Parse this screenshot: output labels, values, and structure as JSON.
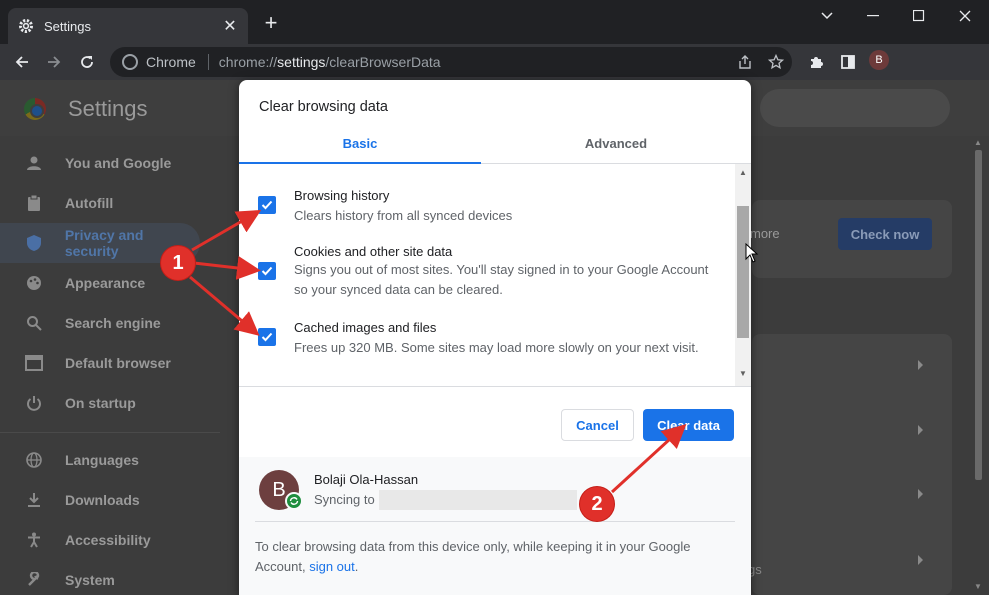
{
  "browser": {
    "tab_title": "Settings",
    "close_glyph": "✕",
    "newtab_glyph": "+",
    "omnibox_chip": "Chrome",
    "url_scheme": "chrome://",
    "url_host": "settings",
    "url_path": "/clearBrowserData",
    "profile_initial": "B"
  },
  "settings": {
    "title": "Settings",
    "sidebar": [
      {
        "label": "You and Google",
        "icon": "person-icon"
      },
      {
        "label": "Autofill",
        "icon": "clipboard-icon"
      },
      {
        "label": "Privacy and security",
        "icon": "shield-icon"
      },
      {
        "label": "Appearance",
        "icon": "palette-icon"
      },
      {
        "label": "Search engine",
        "icon": "search-icon"
      },
      {
        "label": "Default browser",
        "icon": "browser-icon"
      },
      {
        "label": "On startup",
        "icon": "power-icon"
      },
      {
        "label": "Languages",
        "icon": "globe-icon"
      },
      {
        "label": "Downloads",
        "icon": "download-icon"
      },
      {
        "label": "Accessibility",
        "icon": "accessibility-icon"
      },
      {
        "label": "System",
        "icon": "wrench-icon"
      }
    ],
    "safety_more_text": "more",
    "check_now_label": "Check now",
    "partial_text": "gs"
  },
  "dialog": {
    "title": "Clear browsing data",
    "tabs": [
      "Basic",
      "Advanced"
    ],
    "active_tab": "Basic",
    "options": [
      {
        "label": "Browsing history",
        "desc": "Clears history from all synced devices",
        "checked": true
      },
      {
        "label": "Cookies and other site data",
        "desc": "Signs you out of most sites. You'll stay signed in to your Google Account so your synced data can be cleared.",
        "checked": true
      },
      {
        "label": "Cached images and files",
        "desc": "Frees up 320 MB. Some sites may load more slowly on your next visit.",
        "checked": true
      }
    ],
    "cancel_label": "Cancel",
    "clear_label": "Clear data",
    "account": {
      "initial": "B",
      "name": "Bolaji Ola-Hassan",
      "sync_prefix": "Syncing to"
    },
    "footer_note": "To clear browsing data from this device only, while keeping it in your Google Account,",
    "footer_link": "sign out",
    "footer_end": "."
  },
  "annotations": {
    "badge_1": "1",
    "badge_2": "2",
    "arrow_color": "#e0302a"
  },
  "colors": {
    "accent": "#1a73e8",
    "annotation_red": "#e0302a"
  }
}
